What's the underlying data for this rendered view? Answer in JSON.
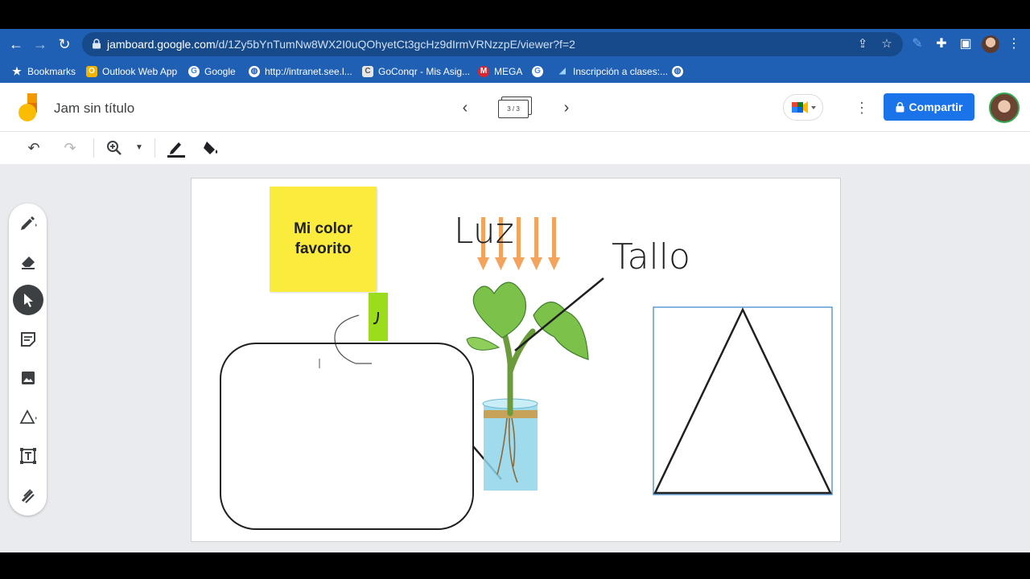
{
  "browser": {
    "url_host": "jamboard.google.com",
    "url_path": "/d/1Zy5bYnTumNw8WX2I0uQOhyetCt3gcHz9dIrmVRNzzpE/viewer?f=2",
    "bookmarks": [
      {
        "label": "Bookmarks",
        "icon": "star-icon"
      },
      {
        "label": "Outlook Web App",
        "icon": "outlook-icon"
      },
      {
        "label": "Google",
        "icon": "google-icon"
      },
      {
        "label": "http://intranet.see.l...",
        "icon": "globe-icon"
      },
      {
        "label": "GoConqr - Mis Asig...",
        "icon": "goconqr-icon"
      },
      {
        "label": "MEGA",
        "icon": "mega-icon"
      },
      {
        "label": "",
        "icon": "google-icon"
      },
      {
        "label": "Inscripción a clases:...",
        "icon": "bookmark-icon"
      },
      {
        "label": "",
        "icon": "globe-icon"
      }
    ]
  },
  "app": {
    "title": "Jam sin título",
    "frame_indicator": "3 / 3",
    "share_label": "Compartir"
  },
  "canvas": {
    "sticky_note": "Mi color favorito",
    "label_luz": "Luz",
    "label_tallo": "Tallo"
  },
  "colors": {
    "chrome_blue": "#1f5fb4",
    "sticky_yellow": "#fbeb3c",
    "accent_green": "#9bdc1c",
    "share_blue": "#1a73e8",
    "arrow_orange": "#f3a35c"
  }
}
